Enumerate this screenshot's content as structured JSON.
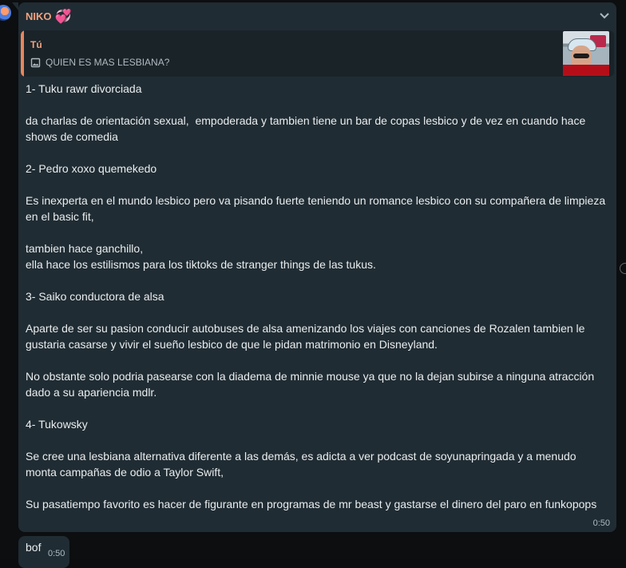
{
  "chat": {
    "sender": "NIKO",
    "sender_emoji": "💞",
    "quoted": {
      "author": "Tú",
      "text": "QUIEN ES MAS LESBIANA?",
      "icon": "image-icon"
    },
    "message": "1- Tuku rawr divorciada\n\nda charlas de orientación sexual,  empoderada y tambien tiene un bar de copas lesbico y de vez en cuando hace shows de comedia\n\n2- Pedro xoxo quemekedo\n\nEs inexperta en el mundo lesbico pero va pisando fuerte teniendo un romance lesbico con su compañera de limpieza en el basic fit,\n\ntambien hace ganchillo,\nella hace los estilismos para los tiktoks de stranger things de las tukus.\n\n3- Saiko conductora de alsa\n\nAparte de ser su pasion conducir autobuses de alsa amenizando los viajes con canciones de Rozalen tambien le gustaria casarse y vivir el sueño lesbico de que le pidan matrimonio en Disneyland.\n\nNo obstante solo podria pasearse con la diadema de minnie mouse ya que no la dejan subirse a ninguna atracción dado a su apariencia mdlr.\n\n4- Tukowsky\n\nSe cree una lesbiana alternativa diferente a las demás, es adicta a ver podcast de soyunapringada y a menudo monta campañas de odio a Taylor Swift,\n\nSu pasatiempo favorito es hacer de figurante en programas de mr beast y gastarse el dinero del paro en funkopops",
    "time": "0:50"
  },
  "next_message": {
    "text": "bof",
    "time": "0:50"
  },
  "colors": {
    "bubble": "#202c33",
    "sender": "#f2a27f",
    "quote_bar": "#e8865c"
  }
}
